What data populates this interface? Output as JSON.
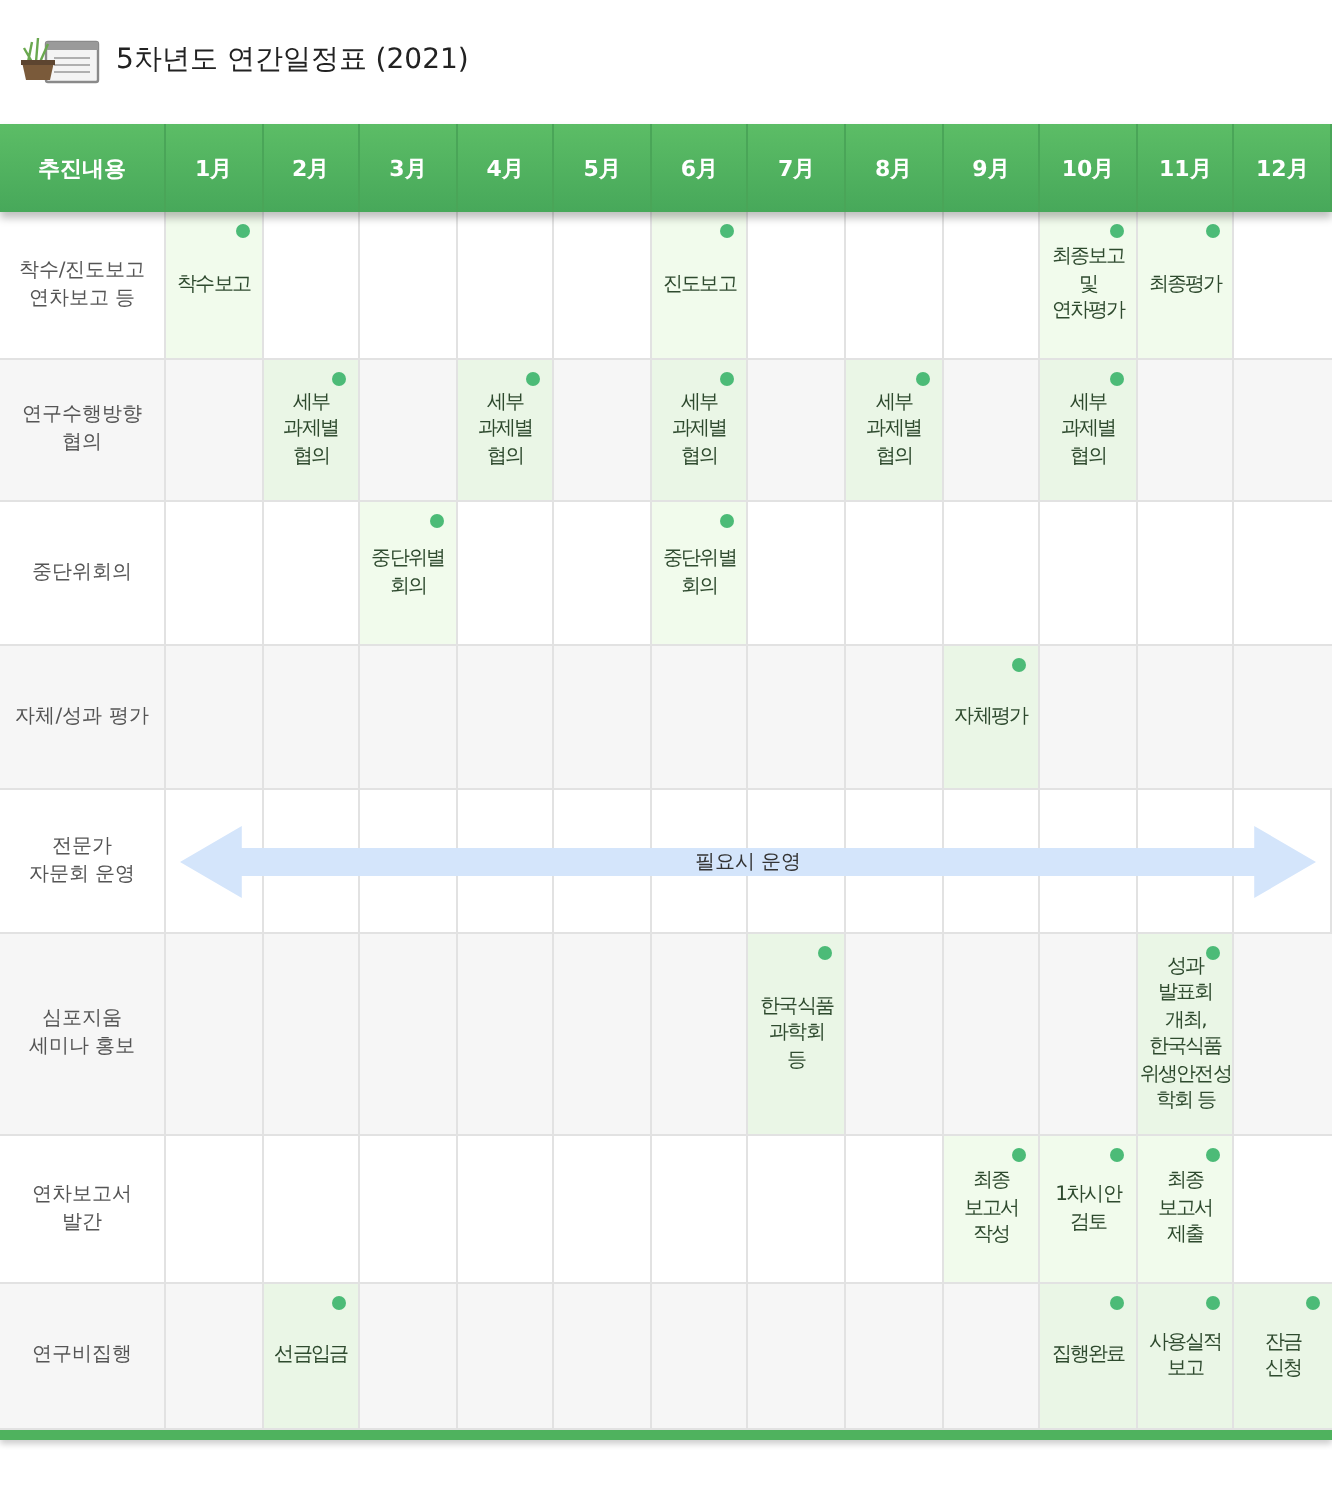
{
  "title": "5차년도 연간일정표 (2021)",
  "columns": [
    "추진내용",
    "1月",
    "2月",
    "3月",
    "4月",
    "5月",
    "6月",
    "7月",
    "8月",
    "9月",
    "10月",
    "11月",
    "12月"
  ],
  "rows": [
    {
      "kind": "events",
      "label": "착수/진도보고\n연차보고 등",
      "cells": [
        {
          "marked": true,
          "text": "착수보고"
        },
        {
          "marked": false
        },
        {
          "marked": false
        },
        {
          "marked": false
        },
        {
          "marked": false
        },
        {
          "marked": true,
          "text": "진도보고"
        },
        {
          "marked": false
        },
        {
          "marked": false
        },
        {
          "marked": false
        },
        {
          "marked": true,
          "text": "최종보고\n및\n연차평가"
        },
        {
          "marked": true,
          "text": "최종평가"
        },
        {
          "marked": false
        }
      ]
    },
    {
      "kind": "events",
      "label": "연구수행방향\n협의",
      "cells": [
        {
          "marked": false
        },
        {
          "marked": true,
          "text": "세부\n과제별\n협의"
        },
        {
          "marked": false
        },
        {
          "marked": true,
          "text": "세부\n과제별\n협의"
        },
        {
          "marked": false
        },
        {
          "marked": true,
          "text": "세부\n과제별\n협의"
        },
        {
          "marked": false
        },
        {
          "marked": true,
          "text": "세부\n과제별\n협의"
        },
        {
          "marked": false
        },
        {
          "marked": true,
          "text": "세부\n과제별\n협의"
        },
        {
          "marked": false
        },
        {
          "marked": false
        }
      ]
    },
    {
      "kind": "events",
      "label": "중단위회의",
      "cells": [
        {
          "marked": false
        },
        {
          "marked": false
        },
        {
          "marked": true,
          "text": "중단위별\n회의"
        },
        {
          "marked": false
        },
        {
          "marked": false
        },
        {
          "marked": true,
          "text": "중단위별\n회의"
        },
        {
          "marked": false
        },
        {
          "marked": false
        },
        {
          "marked": false
        },
        {
          "marked": false
        },
        {
          "marked": false
        },
        {
          "marked": false
        }
      ]
    },
    {
      "kind": "events",
      "label": "자체/성과 평가",
      "cells": [
        {
          "marked": false
        },
        {
          "marked": false
        },
        {
          "marked": false
        },
        {
          "marked": false
        },
        {
          "marked": false
        },
        {
          "marked": false
        },
        {
          "marked": false
        },
        {
          "marked": false
        },
        {
          "marked": true,
          "text": "자체평가"
        },
        {
          "marked": false
        },
        {
          "marked": false
        },
        {
          "marked": false
        }
      ]
    },
    {
      "kind": "span",
      "label": "전문가\n자문회 운영",
      "span_text": "필요시 운영"
    },
    {
      "kind": "events",
      "label": "심포지움\n세미나 홍보",
      "cells": [
        {
          "marked": false
        },
        {
          "marked": false
        },
        {
          "marked": false
        },
        {
          "marked": false
        },
        {
          "marked": false
        },
        {
          "marked": false
        },
        {
          "marked": true,
          "text": "한국식품\n과학회\n등"
        },
        {
          "marked": false
        },
        {
          "marked": false
        },
        {
          "marked": false
        },
        {
          "marked": true,
          "text": "성과\n발표회\n개최,\n한국식품\n위생안전성\n학회 등"
        },
        {
          "marked": false
        }
      ]
    },
    {
      "kind": "events",
      "label": "연차보고서\n발간",
      "cells": [
        {
          "marked": false
        },
        {
          "marked": false
        },
        {
          "marked": false
        },
        {
          "marked": false
        },
        {
          "marked": false
        },
        {
          "marked": false
        },
        {
          "marked": false
        },
        {
          "marked": false
        },
        {
          "marked": true,
          "text": "최종\n보고서\n작성"
        },
        {
          "marked": true,
          "text": "1차시안\n검토"
        },
        {
          "marked": true,
          "text": "최종\n보고서\n제출"
        },
        {
          "marked": false
        }
      ]
    },
    {
      "kind": "events",
      "label": "연구비집행",
      "cells": [
        {
          "marked": false
        },
        {
          "marked": true,
          "text": "선금입금"
        },
        {
          "marked": false
        },
        {
          "marked": false
        },
        {
          "marked": false
        },
        {
          "marked": false
        },
        {
          "marked": false
        },
        {
          "marked": false
        },
        {
          "marked": false
        },
        {
          "marked": true,
          "text": "집행완료"
        },
        {
          "marked": true,
          "text": "사용실적\n보고"
        },
        {
          "marked": true,
          "text": "잔금\n신청"
        }
      ]
    }
  ]
}
